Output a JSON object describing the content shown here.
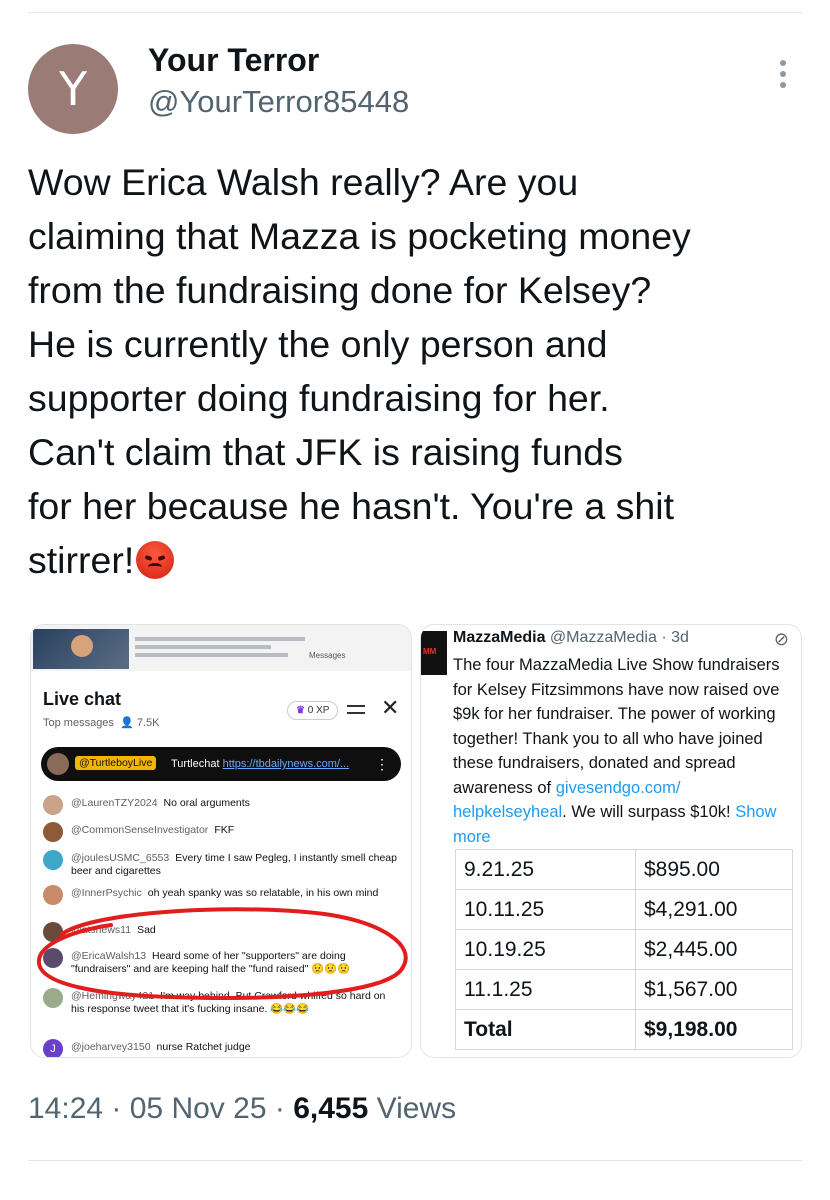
{
  "author": {
    "avatar_letter": "Y",
    "name": "Your Terror",
    "handle": "@YourTerror85448"
  },
  "tweet_text": "Wow Erica Walsh really? Are you\nclaiming that Mazza is pocketing money\nfrom the fundraising done for Kelsey?\nHe is currently the only person and\nsupporter doing fundraising for her.\nCan't claim that JFK is raising funds\nfor her because he hasn't. You're a shit\nstirrer!",
  "emoji": "angry-face",
  "live_chat": {
    "title": "Live chat",
    "subtitle": "Top messages",
    "viewers": "7.5K",
    "xp": "0 XP",
    "messages_label": "Messages",
    "pinned": {
      "user": "@TurtleboyLive",
      "text": "Turtlechat",
      "link": "https://tbdailynews.com/..."
    },
    "messages": [
      {
        "user": "@LaurenTZY2024",
        "text": "No oral arguments",
        "color": "#c9a38a"
      },
      {
        "user": "@CommonSenseInvestigator",
        "text": "FKF",
        "color": "#8f5a3a"
      },
      {
        "user": "@joulesUSMC_6553",
        "text": "Every time I saw Pegleg, I instantly smell cheap beer and cigarettes",
        "color": "#3fa7c9"
      },
      {
        "user": "@InnerPsychic",
        "text": "oh yeah spanky was so relatable, in his own mind",
        "color": "#c98a6a"
      },
      {
        "user": "@atsnews11",
        "text": "Sad",
        "color": "#6a4a3a"
      },
      {
        "user": "@EricaWalsh13",
        "text": "Heard some of her \"supporters\" are doing \"fundraisers\" and are keeping half the \"fund raised\" 😟😟😟",
        "color": "#5b4a6b"
      },
      {
        "user": "@Hemingway421",
        "text": "I'm way behind. But Crawford whiffed so hard on his response tweet that it's fucking insane. 😂😂😂",
        "color": "#9aaa8a"
      },
      {
        "user": "@joeharvey3150",
        "text": "nurse Ratchet judge",
        "color": "#6a3fc9",
        "letter": "J"
      }
    ]
  },
  "mazza_post": {
    "name": "MazzaMedia",
    "handle": "@MazzaMedia",
    "time": "· 3d",
    "body_1": "The four MazzaMedia Live Show fundraisers for Kelsey Fitzsimmons have now raised ove $9k for her fundraiser. The power of working together! Thank you to all who have joined these fundraisers, donated and spread awareness of ",
    "link_1": "givesendgo.com/",
    "link_2": "helpkelseyheal",
    "body_2": ". We will surpass $10k! ",
    "show_more": "Show more",
    "table": [
      {
        "date": "9.21.25",
        "amount": "$895.00"
      },
      {
        "date": "10.11.25",
        "amount": "$4,291.00"
      },
      {
        "date": "10.19.25",
        "amount": "$2,445.00"
      },
      {
        "date": "11.1.25",
        "amount": "$1,567.00"
      }
    ],
    "total_label": "Total",
    "total_amount": "$9,198.00"
  },
  "meta": {
    "time": "14:24",
    "date": "05 Nov 25",
    "views_count": "6,455",
    "views_label": "Views"
  }
}
